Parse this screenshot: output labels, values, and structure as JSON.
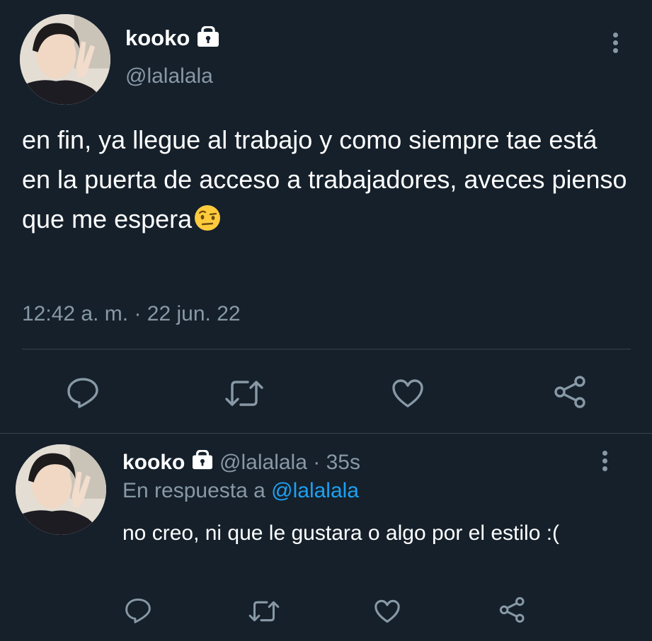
{
  "main_tweet": {
    "display_name": "kooko",
    "handle": "@lalalala",
    "text": "en fin, ya llegue al trabajo y como siempre tae está en la puerta de acceso a trabajadores, aveces pienso que me espera",
    "emoji": "🤨",
    "time": "12:42 a. m.",
    "separator": "·",
    "date": "22 jun. 22",
    "actions": [
      "reply-icon",
      "retweet-icon",
      "like-icon",
      "share-icon"
    ]
  },
  "reply_tweet": {
    "display_name": "kooko",
    "handle": "@lalalala",
    "separator": "·",
    "age": "35s",
    "replying_prefix": "En respuesta a",
    "replying_to": "@lalalala",
    "text": "no creo, ni que le gustara o algo por el estilo :(",
    "actions": [
      "reply-icon",
      "retweet-icon",
      "like-icon",
      "share-icon"
    ]
  },
  "colors": {
    "background": "#15202b",
    "muted": "#8899a6",
    "link": "#1da1f2",
    "divider": "#38444d"
  }
}
